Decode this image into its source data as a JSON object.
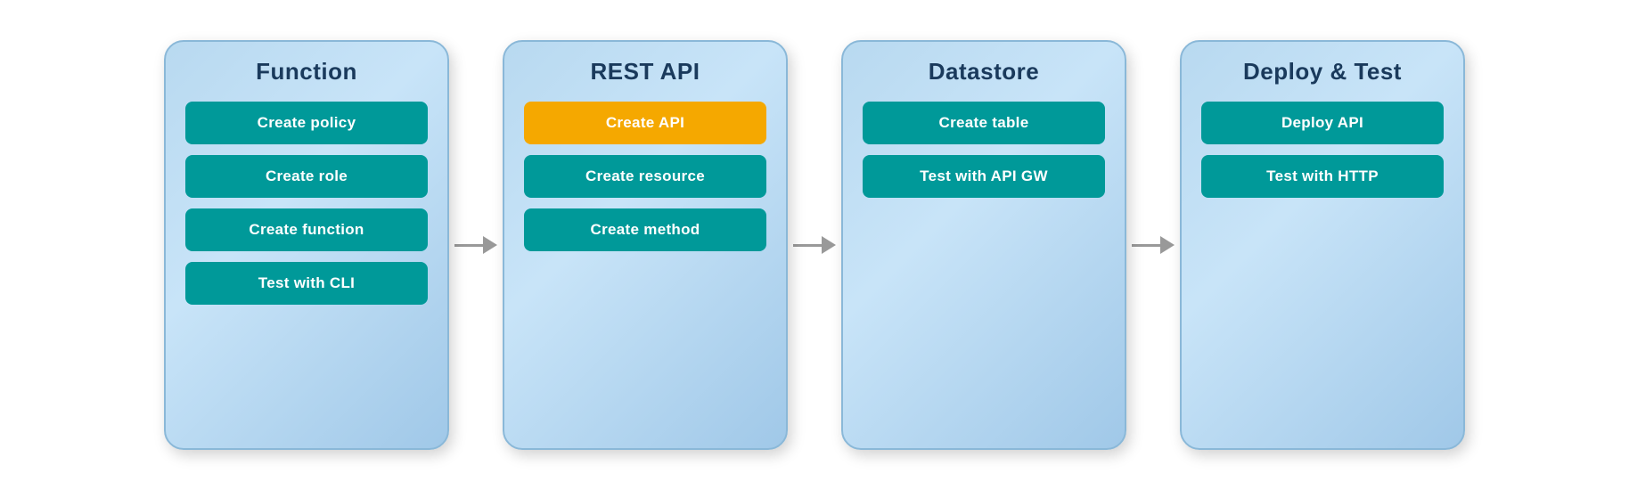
{
  "panels": [
    {
      "id": "function",
      "title": "Function",
      "items": [
        {
          "label": "Create policy",
          "active": false
        },
        {
          "label": "Create role",
          "active": false
        },
        {
          "label": "Create function",
          "active": false
        },
        {
          "label": "Test with CLI",
          "active": false
        }
      ]
    },
    {
      "id": "rest-api",
      "title": "REST API",
      "items": [
        {
          "label": "Create API",
          "active": true
        },
        {
          "label": "Create resource",
          "active": false
        },
        {
          "label": "Create method",
          "active": false
        }
      ]
    },
    {
      "id": "datastore",
      "title": "Datastore",
      "items": [
        {
          "label": "Create table",
          "active": false
        },
        {
          "label": "Test with API GW",
          "active": false
        }
      ]
    },
    {
      "id": "deploy-test",
      "title": "Deploy & Test",
      "items": [
        {
          "label": "Deploy API",
          "active": false
        },
        {
          "label": "Test with HTTP",
          "active": false
        }
      ]
    }
  ],
  "arrows": [
    {
      "id": "arrow-1"
    },
    {
      "id": "arrow-2"
    },
    {
      "id": "arrow-3"
    }
  ]
}
